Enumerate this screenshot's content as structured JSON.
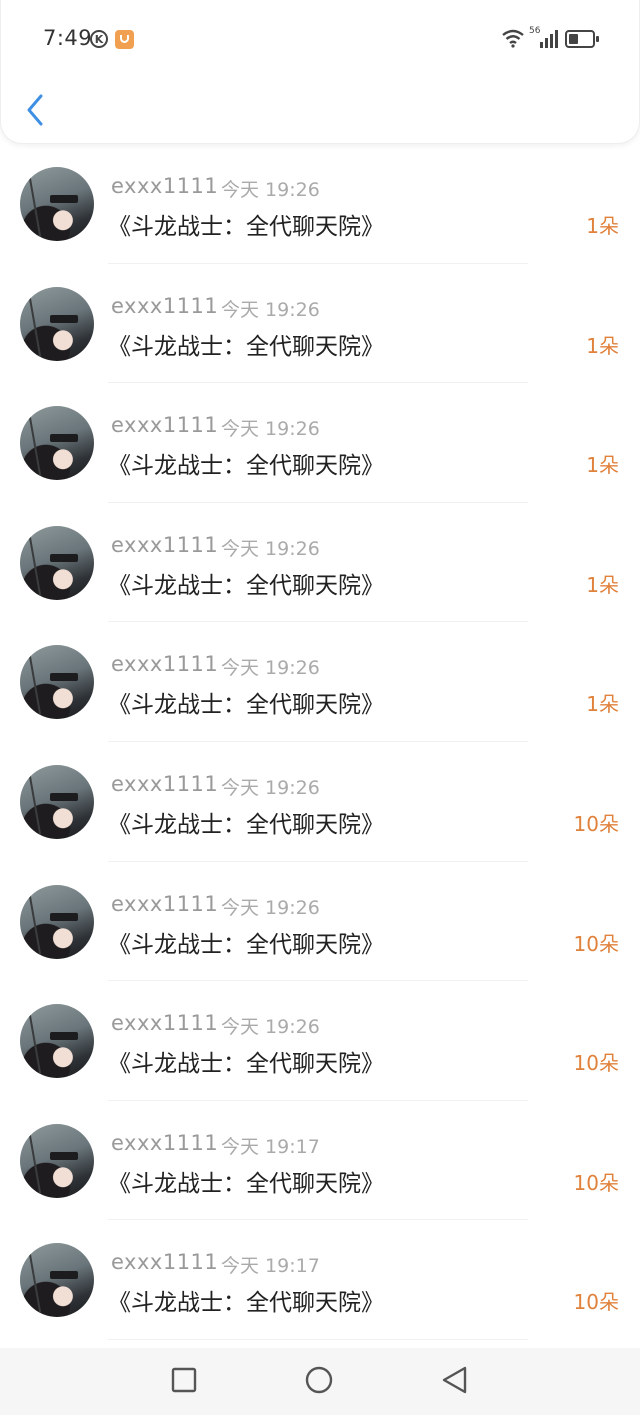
{
  "status_bar": {
    "time": "7:49",
    "k_badge": "K",
    "network_label": "56"
  },
  "header": {
    "back_icon": "chevron-left-icon",
    "accent_color": "#3f8fe3"
  },
  "records": [
    {
      "user": "exxx1111",
      "time": "今天 19:26",
      "gift": "《斗龙战士：全代聊天院》",
      "count": "1朵"
    },
    {
      "user": "exxx1111",
      "time": "今天 19:26",
      "gift": "《斗龙战士：全代聊天院》",
      "count": "1朵"
    },
    {
      "user": "exxx1111",
      "time": "今天 19:26",
      "gift": "《斗龙战士：全代聊天院》",
      "count": "1朵"
    },
    {
      "user": "exxx1111",
      "time": "今天 19:26",
      "gift": "《斗龙战士：全代聊天院》",
      "count": "1朵"
    },
    {
      "user": "exxx1111",
      "time": "今天 19:26",
      "gift": "《斗龙战士：全代聊天院》",
      "count": "1朵"
    },
    {
      "user": "exxx1111",
      "time": "今天 19:26",
      "gift": "《斗龙战士：全代聊天院》",
      "count": "10朵"
    },
    {
      "user": "exxx1111",
      "time": "今天 19:26",
      "gift": "《斗龙战士：全代聊天院》",
      "count": "10朵"
    },
    {
      "user": "exxx1111",
      "time": "今天 19:26",
      "gift": "《斗龙战士：全代聊天院》",
      "count": "10朵"
    },
    {
      "user": "exxx1111",
      "time": "今天 19:17",
      "gift": "《斗龙战士：全代聊天院》",
      "count": "10朵"
    },
    {
      "user": "exxx1111",
      "time": "今天 19:17",
      "gift": "《斗龙战士：全代聊天院》",
      "count": "10朵"
    }
  ],
  "nav_bar": {
    "icons": [
      "recent-apps-icon",
      "home-icon",
      "back-icon"
    ]
  },
  "colors": {
    "count": "#e0823c",
    "username": "#999999",
    "gift_text": "#222222"
  }
}
